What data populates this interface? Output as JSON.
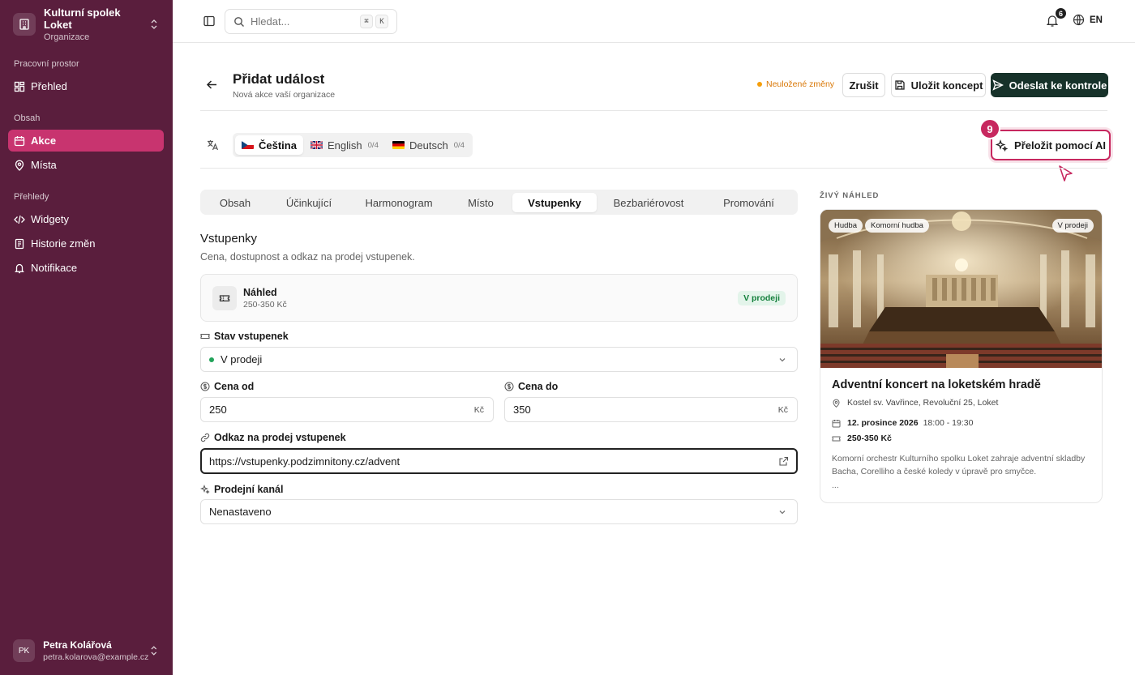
{
  "sidebar": {
    "org_name": "Kulturní spolek Loket",
    "org_sub": "Organizace",
    "sections": {
      "workspace": "Pracovní prostor",
      "content": "Obsah",
      "overviews": "Přehledy"
    },
    "items": [
      {
        "label": "Přehled",
        "icon": "grid-icon"
      },
      {
        "label": "Akce",
        "icon": "calendar-icon",
        "active": true
      },
      {
        "label": "Místa",
        "icon": "map-pin-icon"
      },
      {
        "label": "Widgety",
        "icon": "code-icon"
      },
      {
        "label": "Historie změn",
        "icon": "history-icon"
      },
      {
        "label": "Notifikace",
        "icon": "bell-icon"
      }
    ],
    "user": {
      "initials": "PK",
      "name": "Petra Kolářová",
      "email": "petra.kolarova@example.cz"
    }
  },
  "topbar": {
    "search_placeholder": "Hledat...",
    "kbd1": "⌘",
    "kbd2": "K",
    "notif_count": "6",
    "lang": "EN"
  },
  "header": {
    "title": "Přidat událost",
    "subtitle": "Nová akce vaší organizace",
    "unsaved": "Neuložené změny",
    "cancel": "Zrušit",
    "save_draft": "Uložit koncept",
    "submit": "Odeslat ke kontrole"
  },
  "lang_tabs": [
    {
      "label": "Čeština",
      "count": "",
      "active": true
    },
    {
      "label": "English",
      "count": "0/4"
    },
    {
      "label": "Deutsch",
      "count": "0/4"
    }
  ],
  "ai_translate": {
    "label": "Přeložit pomocí AI",
    "step": "9"
  },
  "section_tabs": [
    "Obsah",
    "Účinkující",
    "Harmonogram",
    "Místo",
    "Vstupenky",
    "Bezbariérovost",
    "Promování"
  ],
  "active_section_tab": "Vstupenky",
  "tickets": {
    "title": "Vstupenky",
    "description": "Cena, dostupnost a odkaz na prodej vstupenek.",
    "preview_title": "Náhled",
    "preview_price": "250-350 Kč",
    "preview_badge": "V prodeji",
    "status_label": "Stav vstupenek",
    "status_value": "V prodeji",
    "price_from_label": "Cena od",
    "price_from": "250",
    "price_to_label": "Cena do",
    "price_to": "350",
    "currency": "Kč",
    "link_label": "Odkaz na prodej vstupenek",
    "link_value": "https://vstupenky.podzimnitony.cz/advent",
    "channel_label": "Prodejní kanál",
    "channel_value": "Nenastaveno"
  },
  "live_preview": {
    "label": "ŽIVÝ NÁHLED",
    "tags": [
      "Hudba",
      "Komorní hudba"
    ],
    "status_tag": "V prodeji",
    "title": "Adventní koncert na loketském hradě",
    "location": "Kostel sv. Vavřince, Revoluční 25, Loket",
    "date": "12. prosince 2026",
    "time": "18:00 - 19:30",
    "price": "250-350 Kč",
    "description": "Komorní orchestr Kulturního spolku Loket zahraje adventní skladby Bacha, Corelliho a české koledy v úpravě pro smyčce.",
    "more": "..."
  },
  "colors": {
    "sidebar_bg": "#5a1e3d",
    "sidebar_active": "#c8346f",
    "primary_button": "#17322a",
    "highlight": "#c7285f",
    "unsaved": "#d97706",
    "badge_green": "#15803d"
  }
}
